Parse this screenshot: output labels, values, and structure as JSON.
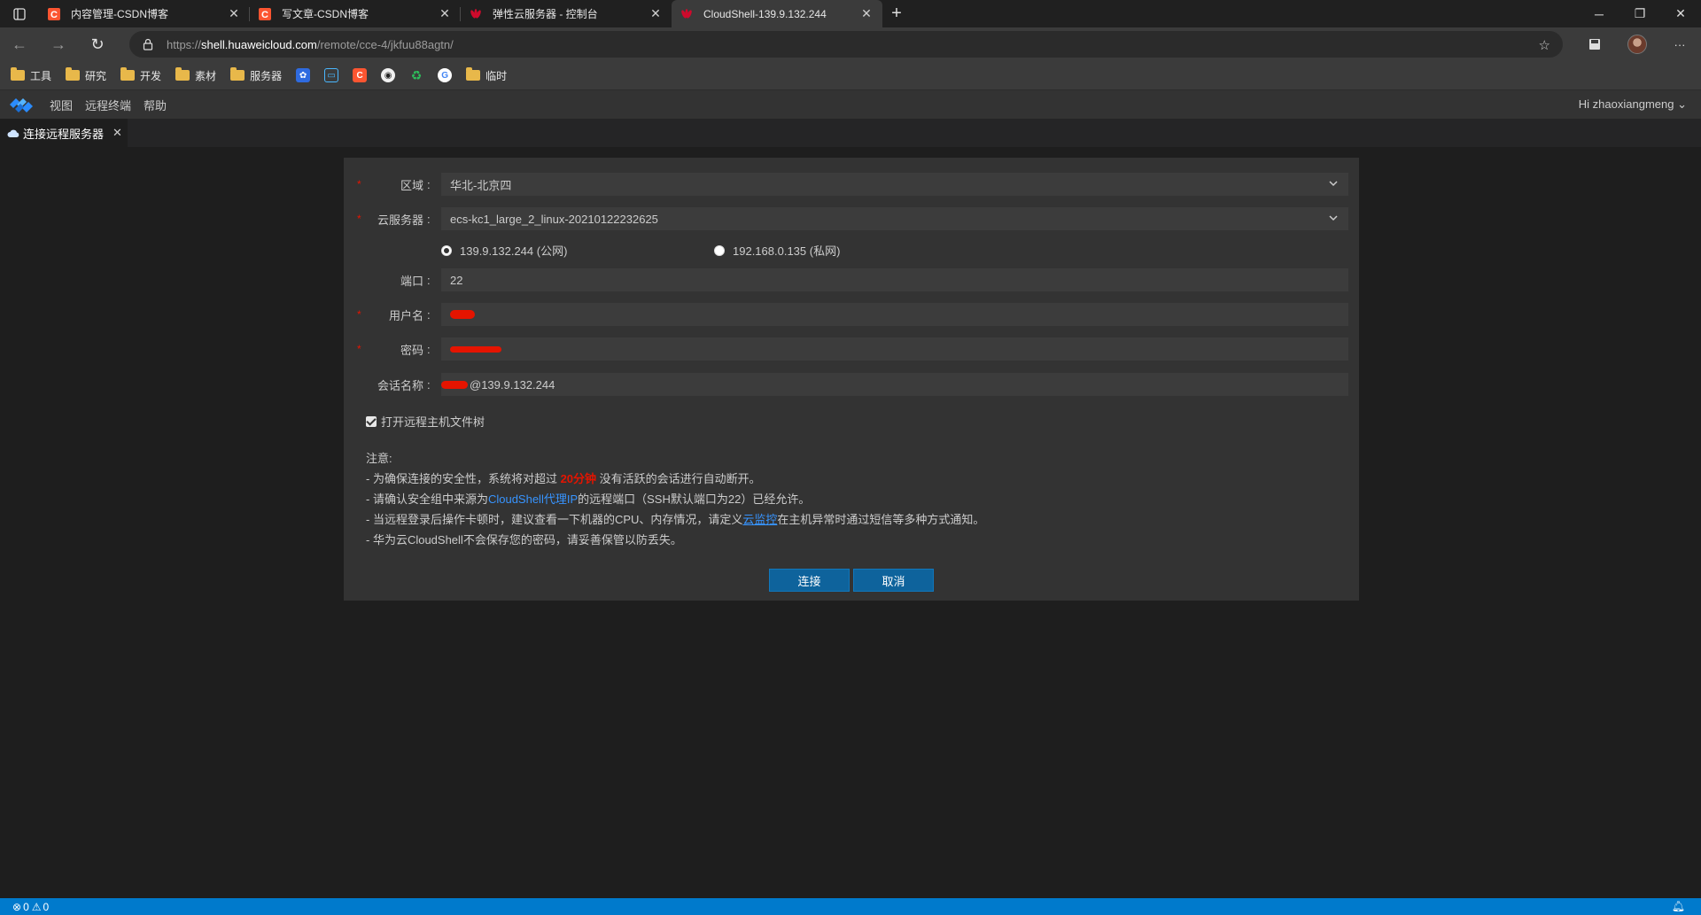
{
  "browser": {
    "tabs": [
      {
        "title": "内容管理-CSDN博客",
        "favicon": "csdn-icon",
        "active": false
      },
      {
        "title": "写文章-CSDN博客",
        "favicon": "csdn-icon",
        "active": false
      },
      {
        "title": "弹性云服务器 - 控制台",
        "favicon": "huawei-icon",
        "active": false
      },
      {
        "title": "CloudShell-139.9.132.244",
        "favicon": "huawei-icon",
        "active": true
      }
    ],
    "url_prefix": "https://",
    "url_host": "shell.huaweicloud.com",
    "url_path": "/remote/cce-4/jkfuu88agtn/",
    "bookmarks": [
      {
        "label": "工具",
        "type": "folder"
      },
      {
        "label": "研究",
        "type": "folder"
      },
      {
        "label": "开发",
        "type": "folder"
      },
      {
        "label": "素材",
        "type": "folder"
      },
      {
        "label": "服务器",
        "type": "folder"
      }
    ],
    "bookmark_last": "临时"
  },
  "app": {
    "menu": [
      "视图",
      "远程终端",
      "帮助"
    ],
    "user_greeting": "Hi zhaoxiangmeng",
    "tab_label": "连接远程服务器"
  },
  "form": {
    "region_label": "区域",
    "region_value": "华北-北京四",
    "server_label": "云服务器",
    "server_value": "ecs-kc1_large_2_linux-20210122232625",
    "ip_public": "139.9.132.244 (公网)",
    "ip_private": "192.168.0.135 (私网)",
    "port_label": "端口",
    "port_value": "22",
    "username_label": "用户名",
    "password_label": "密码",
    "session_label": "会话名称",
    "session_suffix": "@139.9.132.244",
    "filetree_label": "打开远程主机文件树",
    "colon": ":"
  },
  "notes": {
    "title": "注意:",
    "line1_a": "- 为确保连接的安全性，系统将对超过 ",
    "line1_hl": "20分钟",
    "line1_b": " 没有活跃的会话进行自动断开。",
    "line2_a": "- 请确认安全组中来源为",
    "line2_link": "CloudShell代理IP",
    "line2_b": "的远程端口（SSH默认端口为22）已经允许。",
    "line3_a": "- 当远程登录后操作卡顿时，建议查看一下机器的CPU、内存情况，请定义",
    "line3_link": "云监控",
    "line3_b": "在主机异常时通过短信等多种方式通知。",
    "line4": "- 华为云CloudShell不会保存您的密码，请妥善保管以防丢失。"
  },
  "buttons": {
    "connect": "连接",
    "cancel": "取消"
  },
  "status": {
    "errors": "0",
    "warnings": "0"
  },
  "colors": {
    "accent": "#007acc",
    "button": "#0e639c",
    "required": "#e51400",
    "link": "#3794ff"
  }
}
